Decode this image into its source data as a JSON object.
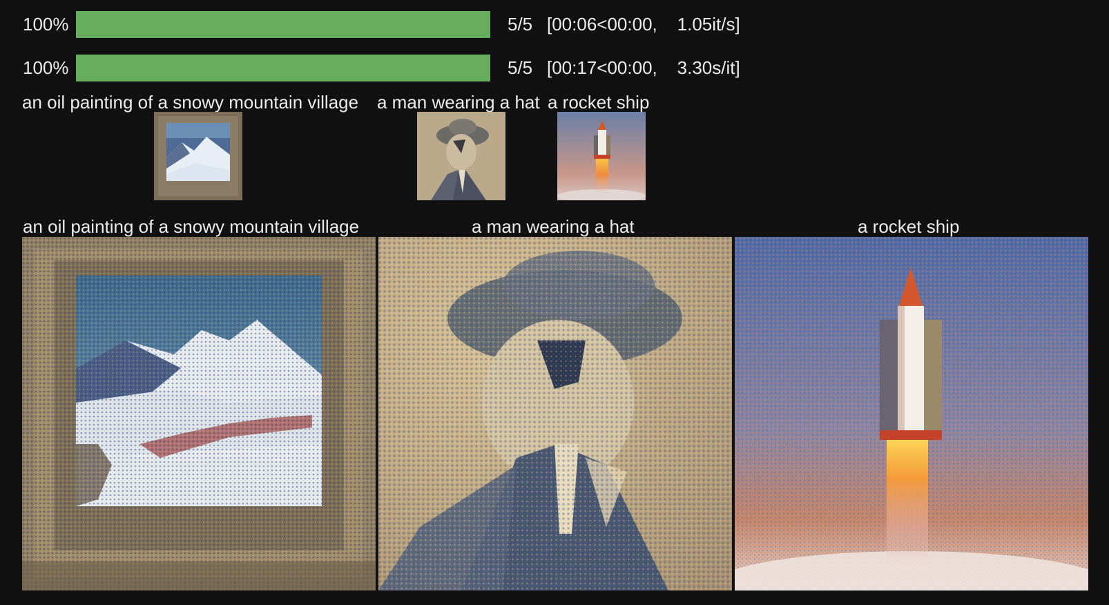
{
  "progress": [
    {
      "percent_label": "100%",
      "fraction": 1.0,
      "steps": "5/5",
      "timing": "[00:06<00:00,    1.05it/s]"
    },
    {
      "percent_label": "100%",
      "fraction": 1.0,
      "steps": "5/5",
      "timing": "[00:17<00:00,    3.30s/it]"
    }
  ],
  "thumbnails": {
    "captions": [
      "an oil painting of a snowy mountain village",
      "a man wearing a hat",
      "a rocket ship"
    ]
  },
  "gallery": {
    "captions": [
      "an oil painting of a snowy mountain village",
      "a man wearing a hat",
      "a rocket ship"
    ]
  },
  "colors": {
    "background": "#111111",
    "progress_fill": "#66ad5e",
    "text": "#ececec"
  }
}
